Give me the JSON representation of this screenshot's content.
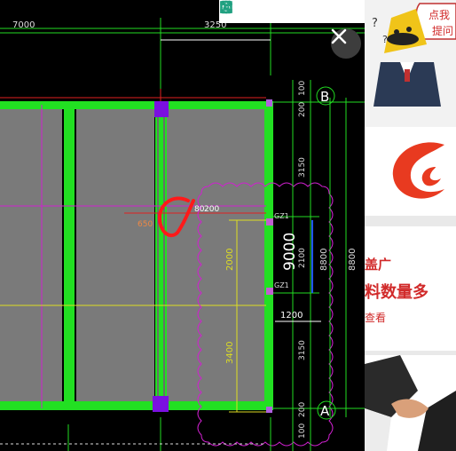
{
  "toolbar": {
    "buttons": [
      {
        "name": "fit-page-button",
        "icon": "page-icon"
      },
      {
        "name": "fullscreen-button",
        "icon": "expand-icon"
      },
      {
        "name": "save-button",
        "icon": "floppy-disk-icon"
      },
      {
        "name": "share-button",
        "icon": "share-arrow-icon"
      },
      {
        "name": "settings-button",
        "icon": "gear-icon"
      }
    ]
  },
  "close": {
    "icon": "close-icon"
  },
  "drawing": {
    "top_dims": [
      "7000",
      "3250"
    ],
    "grid_b": "B",
    "grid_a": "A",
    "dims_right": [
      "100",
      "200",
      "3150",
      "2100",
      "3150",
      "200",
      "100"
    ],
    "dims_total": [
      "8800",
      "8800"
    ],
    "dim_mid": "9000",
    "dim_left_vert": [
      "2000",
      "3400"
    ],
    "dim_horizontal": "1200",
    "label_200": "200",
    "label_650": "650",
    "label_80": "80",
    "gz1": "GZ1",
    "gz2": "GZ1",
    "colors": {
      "beam": "#22e022",
      "column": "#9900ff",
      "slab": "#7a7a7a",
      "dim": "#22dd22",
      "cloud": "#d020d0"
    }
  },
  "sidebar": {
    "ad1_bubble": [
      "点我",
      "提问"
    ],
    "ad3_line1": "盖广",
    "ad3_line2": "料数量多",
    "ad3_line3": "查看"
  }
}
